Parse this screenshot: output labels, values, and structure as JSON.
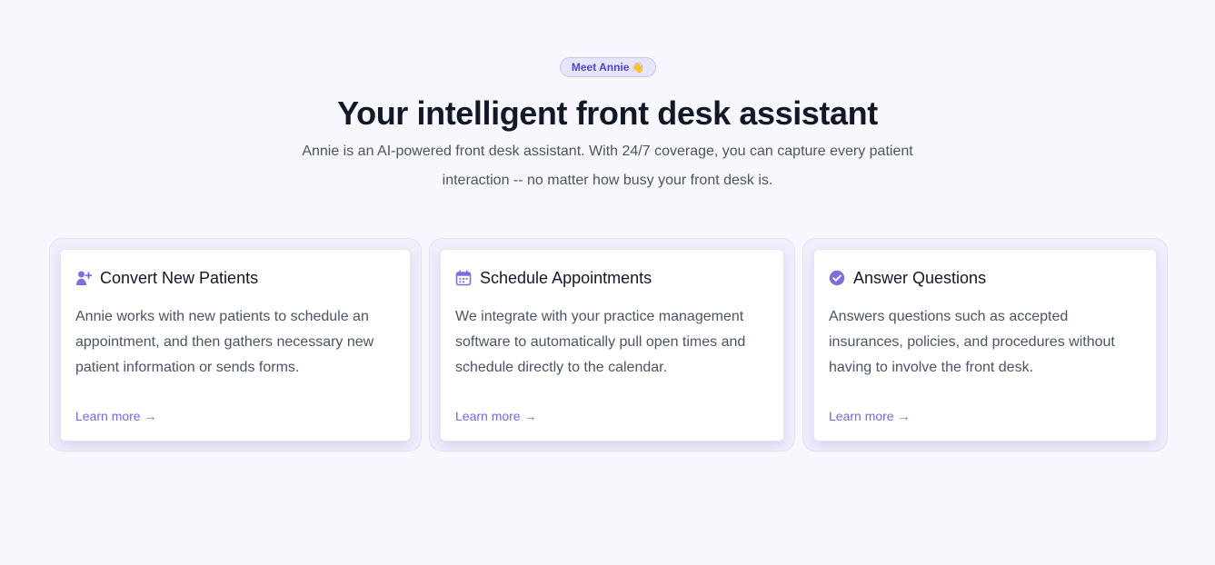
{
  "hero": {
    "badge_label": "Meet Annie",
    "badge_emoji": "👋",
    "title": "Your intelligent front desk assistant",
    "subtitle": "Annie is an AI-powered front desk assistant. With 24/7 coverage, you can capture every patient interaction -- no matter how busy your front desk is."
  },
  "features": [
    {
      "icon": "add-user-icon",
      "title": "Convert New Patients",
      "description": "Annie works with new patients to schedule an appointment, and then gathers necessary new patient information or sends forms.",
      "link_label": "Learn more →"
    },
    {
      "icon": "calendar-icon",
      "title": "Schedule Appointments",
      "description": "We integrate with your practice management software to automatically pull open times and schedule directly to the calendar.",
      "link_label": "Learn more →"
    },
    {
      "icon": "check-circle-icon",
      "title": "Answer Questions",
      "description": "Answers questions such as accepted insurances, policies, and procedures without having to involve the front desk.",
      "link_label": "Learn more →"
    }
  ],
  "colors": {
    "accent": "#7868d8",
    "badge_background": "#e6e5fc",
    "badge_text": "#4f46c8",
    "background": "#f7f7fd",
    "heading": "#111827",
    "body_text": "#4b5563"
  }
}
